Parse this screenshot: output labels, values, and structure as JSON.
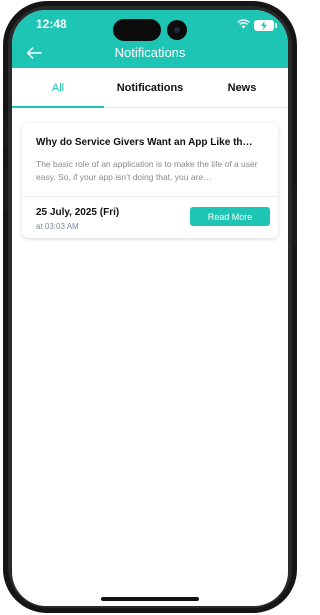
{
  "status_bar": {
    "time": "12:48",
    "icons": [
      "wifi-icon",
      "battery-charging-icon"
    ]
  },
  "header": {
    "title": "Notifications",
    "back_icon": "arrow-left-icon",
    "color": "#1ec4b4"
  },
  "tabs": [
    {
      "label": "All",
      "active": true
    },
    {
      "label": "Notifications",
      "active": false
    },
    {
      "label": "News",
      "active": false
    }
  ],
  "notifications": [
    {
      "title": "Why do Service Givers Want an App Like th…",
      "body": "The basic role of an application is to make the life of a user easy. So, if your app isn’t doing that, you are…",
      "date": "25 July, 2025 (Fri)",
      "time": "at 03:03 AM",
      "action_label": "Read More"
    }
  ]
}
